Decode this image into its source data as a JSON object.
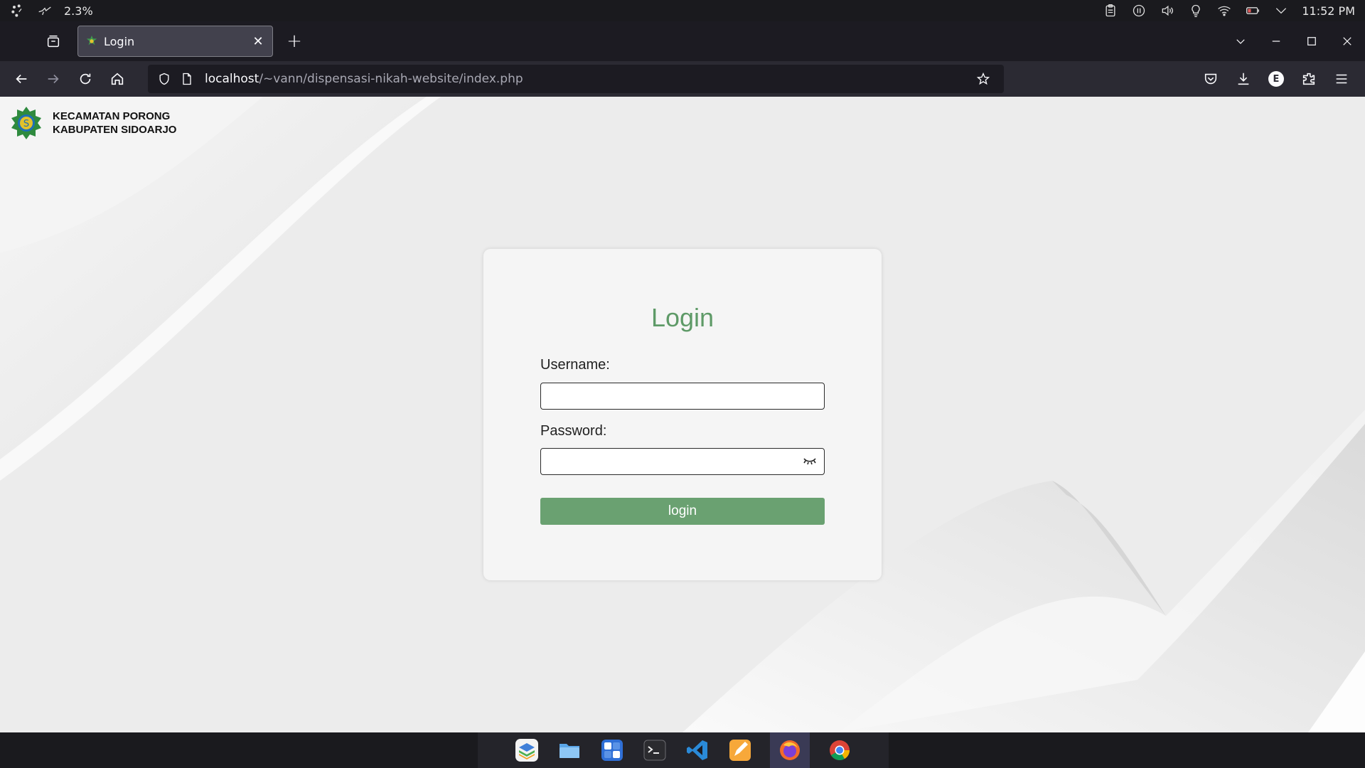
{
  "system": {
    "cpu_label": "2.3%",
    "time": "11:52 PM"
  },
  "browser": {
    "tab_title": "Login",
    "url_host": "localhost",
    "url_path": "/~vann/dispensasi-nikah-website/index.php",
    "account_initial": "E"
  },
  "page": {
    "brand_line1": "KECAMATAN PORONG",
    "brand_line2": "KABUPATEN SIDOARJO",
    "login_title": "Login",
    "username_label": "Username:",
    "username_value": "",
    "password_label": "Password:",
    "password_value": "",
    "submit_label": "login",
    "accent_color": "#6aa171"
  },
  "dock": {
    "items": [
      "layers-app-icon",
      "files-icon",
      "calculator-icon",
      "terminal-icon",
      "vscode-icon",
      "text-editor-icon",
      "firefox-icon",
      "chrome-icon"
    ]
  }
}
